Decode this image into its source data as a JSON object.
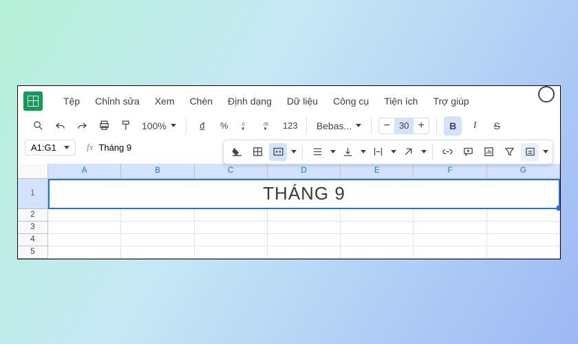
{
  "app": {
    "logo_name": "google-sheets"
  },
  "menus": [
    "Tệp",
    "Chỉnh sửa",
    "Xem",
    "Chèn",
    "Định dạng",
    "Dữ liệu",
    "Công cụ",
    "Tiện ích",
    "Trợ giúp"
  ],
  "toolbar": {
    "zoom": "100%",
    "currency_symbol": "đ",
    "percent": "%",
    "dec_decrease": ".0",
    "dec_increase": ".00",
    "num_format": "123",
    "font": "Bebas...",
    "font_size": "30",
    "minus": "−",
    "plus": "+",
    "bold": "B",
    "italic": "I",
    "strike": "S"
  },
  "formula_bar": {
    "range": "A1:G1",
    "fx_label": "fx",
    "value": "Tháng 9"
  },
  "sheet": {
    "columns": [
      "A",
      "B",
      "C",
      "D",
      "E",
      "F",
      "G"
    ],
    "rows": [
      "1",
      "2",
      "3",
      "4",
      "5"
    ],
    "merged_cell_text": "THÁNG 9",
    "selected_range": "A1:G1"
  },
  "colors": {
    "accent": "#1a73e8",
    "sheets_green": "#0f9d58",
    "highlight": "#d3e3fd"
  }
}
